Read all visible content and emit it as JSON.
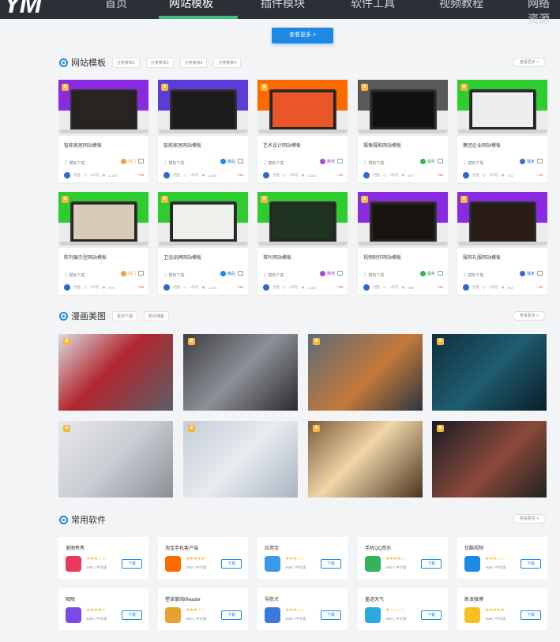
{
  "logo": "YM",
  "nav": [
    "首页",
    "网站模板",
    "插件模块",
    "软件工具",
    "视频教程",
    "网络资源"
  ],
  "more_button": "查看更多 >",
  "see_more": "查看更多 >",
  "sections": {
    "templates": {
      "title": "网站模板",
      "tags": [
        "分类菜单1",
        "分类菜单2",
        "分类菜单3",
        "分类菜单4"
      ]
    },
    "comics": {
      "title": "漫画美图",
      "tags": [
        "素材下载",
        "新闻博客"
      ]
    },
    "software": {
      "title": "常用软件"
    }
  },
  "template_cards": [
    {
      "title": "智能家居网站模板",
      "dl": "模板下载",
      "pill": "热门",
      "pill_color": "#f0a040",
      "author": "优酷",
      "time": "1年前",
      "views": "2,100",
      "likes": "99",
      "top": "#8a2be2",
      "screen": "#2a2420"
    },
    {
      "title": "智能家居网站模板",
      "dl": "模板下载",
      "pill": "精品",
      "pill_color": "#1e88e5",
      "author": "优酷",
      "time": "1年前",
      "views": "2,864",
      "likes": "88",
      "top": "#5b3cd8",
      "screen": "#1c1c1c"
    },
    {
      "title": "艺术设计网站模板",
      "dl": "模板下载",
      "pill": "推荐",
      "pill_color": "#a84bd6",
      "author": "优酷",
      "time": "1年前",
      "views": "2,301",
      "likes": "66",
      "top": "#ff6a00",
      "screen": "#e8562a"
    },
    {
      "title": "摄像摄影网站模板",
      "dl": "模板下载",
      "pill": "最新",
      "pill_color": "#33b35a",
      "author": "优酷",
      "time": "1年前",
      "views": "947",
      "likes": "88",
      "top": "#5a5a5a",
      "screen": "#101010"
    },
    {
      "title": "集团企业网站模板",
      "dl": "模板下载",
      "pill": "独家",
      "pill_color": "#3a6ad4",
      "author": "优酷",
      "time": "1年前",
      "views": "741",
      "likes": "66",
      "top": "#2ecc2e",
      "screen": "#eeeeee"
    },
    {
      "title": "陈列展示型网站模板",
      "dl": "模板下载",
      "pill": "热门",
      "pill_color": "#f0a040",
      "author": "优酷",
      "time": "1年前",
      "views": "879",
      "likes": "88",
      "top": "#2ecc2e",
      "screen": "#d8ccb8"
    },
    {
      "title": "卫浴品牌网站模板",
      "dl": "模板下载",
      "pill": "精品",
      "pill_color": "#1e88e5",
      "author": "优酷",
      "time": "1年前",
      "views": "1,124",
      "likes": "86",
      "top": "#2ecc2e",
      "screen": "#eef0ec"
    },
    {
      "title": "茶叶网站模板",
      "dl": "模板下载",
      "pill": "推荐",
      "pill_color": "#a84bd6",
      "author": "优酷",
      "time": "1年前",
      "views": "1,022",
      "likes": "88",
      "top": "#2ecc2e",
      "screen": "#1e3320"
    },
    {
      "title": "视频制作网站模板",
      "dl": "模板下载",
      "pill": "最新",
      "pill_color": "#33b35a",
      "author": "优酷",
      "time": "1年前",
      "views": "989",
      "likes": "66",
      "top": "#8a2be2",
      "screen": "#1a1410"
    },
    {
      "title": "服饰礼服网站模板",
      "dl": "模板下载",
      "pill": "独家",
      "pill_color": "#3a6ad4",
      "author": "优酷",
      "time": "1年前",
      "views": "942",
      "likes": "88",
      "top": "#8a2be2",
      "screen": "#2a1c14"
    }
  ],
  "comic_cards": [
    {
      "bg": "linear-gradient(135deg,#d9dde2,#b2262e 45%,#5a5f66)"
    },
    {
      "bg": "linear-gradient(135deg,#3d3f44,#8d9096 50%,#2a2b2f)"
    },
    {
      "bg": "linear-gradient(135deg,#5d6b78,#c47a3a 55%,#2c3540)"
    },
    {
      "bg": "linear-gradient(135deg,#0f2e3c,#1f5d70 50%,#0a1e28)"
    },
    {
      "bg": "linear-gradient(135deg,#e6e8ec,#c9ccd2 50%,#8c8f96)"
    },
    {
      "bg": "linear-gradient(135deg,#c4ccd6,#e8ecf0 50%,#aab4c0)"
    },
    {
      "bg": "linear-gradient(135deg,#7a5a3a,#f0d6a8 45%,#4a3320)"
    },
    {
      "bg": "linear-gradient(135deg,#1a1a24,#8a4a3a 55%,#222)"
    }
  ],
  "software": [
    {
      "name": "美图秀秀",
      "icon": "#e83a5a",
      "stars": "★★★☆☆",
      "size": "3MB",
      "lang": "中文版",
      "btn": "下载"
    },
    {
      "name": "淘宝手机客户端",
      "icon": "#ff6a00",
      "stars": "★★★★★",
      "size": "3MB",
      "lang": "中文版",
      "btn": "下载"
    },
    {
      "name": "应用宝",
      "icon": "#3a9ae8",
      "stars": "★★★☆☆",
      "size": "3MB",
      "lang": "中文版",
      "btn": "下载"
    },
    {
      "name": "手机QQ音乐",
      "icon": "#33b35a",
      "stars": "★★★★☆",
      "size": "4MB",
      "lang": "中文版",
      "btn": "下载"
    },
    {
      "name": "优酷视频",
      "icon": "#1e88e5",
      "stars": "★★★☆☆",
      "size": "3MB",
      "lang": "中文版",
      "btn": "下载"
    },
    {
      "name": "陌陌",
      "icon": "#7a4ae8",
      "stars": "★★★★☆",
      "size": "3MB",
      "lang": "中文版",
      "btn": "下载"
    },
    {
      "name": "塑读掌阅iReader",
      "icon": "#e8a030",
      "stars": "★★★☆☆",
      "size": "3MB",
      "lang": "中文版",
      "btn": "下载"
    },
    {
      "name": "导航犬",
      "icon": "#3a7ad8",
      "stars": "★★★☆☆",
      "size": "4MB",
      "lang": "中文版",
      "btn": "下载"
    },
    {
      "name": "墨迹天气",
      "icon": "#2aa8e0",
      "stars": "★☆☆☆☆",
      "size": "3MB",
      "lang": "中文版",
      "btn": "下载"
    },
    {
      "name": "新浪微博",
      "icon": "#f6c020",
      "stars": "★★★★★",
      "size": "3MB",
      "lang": "中文版",
      "btn": "下载"
    }
  ]
}
